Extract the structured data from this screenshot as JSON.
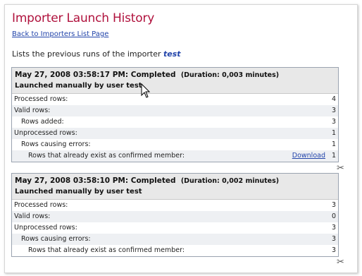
{
  "page": {
    "title": "Importer Launch History",
    "back_link": "Back to Importers List Page",
    "intro_text": "Lists the previous runs of the importer ",
    "importer_name": "test"
  },
  "runs": [
    {
      "status": "May 27, 2008 03:58:17 PM: Completed",
      "duration": "(Duration: 0,003 minutes)",
      "launcher": "Launched manually by user test",
      "rows": [
        {
          "label": "Processed rows:",
          "value": "4"
        },
        {
          "label": "Valid rows:",
          "value": "3"
        },
        {
          "label": "Rows added:",
          "value": "3"
        },
        {
          "label": "Unprocessed rows:",
          "value": "1"
        },
        {
          "label": "Rows causing errors:",
          "value": "1"
        },
        {
          "label": "Rows that already exist as confirmed member:",
          "value": "1",
          "action": "Download"
        }
      ]
    },
    {
      "status": "May 27, 2008 03:58:10 PM: Completed",
      "duration": "(Duration: 0,002 minutes)",
      "launcher": "Launched manually by user test",
      "rows": [
        {
          "label": "Processed rows:",
          "value": "3"
        },
        {
          "label": "Valid rows:",
          "value": "0"
        },
        {
          "label": "Unprocessed rows:",
          "value": "3"
        },
        {
          "label": "Rows causing errors:",
          "value": "3"
        },
        {
          "label": "Rows that already exist as confirmed member:",
          "value": "3"
        }
      ]
    }
  ],
  "icons": {
    "scissors": "scissors-icon",
    "cursor": "mouse-cursor-icon"
  },
  "colors": {
    "title": "#b0123d",
    "link": "#2244aa",
    "header_bg": "#e8e8e8",
    "alt_row_bg": "#eef0f3",
    "border": "#9aa3b0"
  }
}
